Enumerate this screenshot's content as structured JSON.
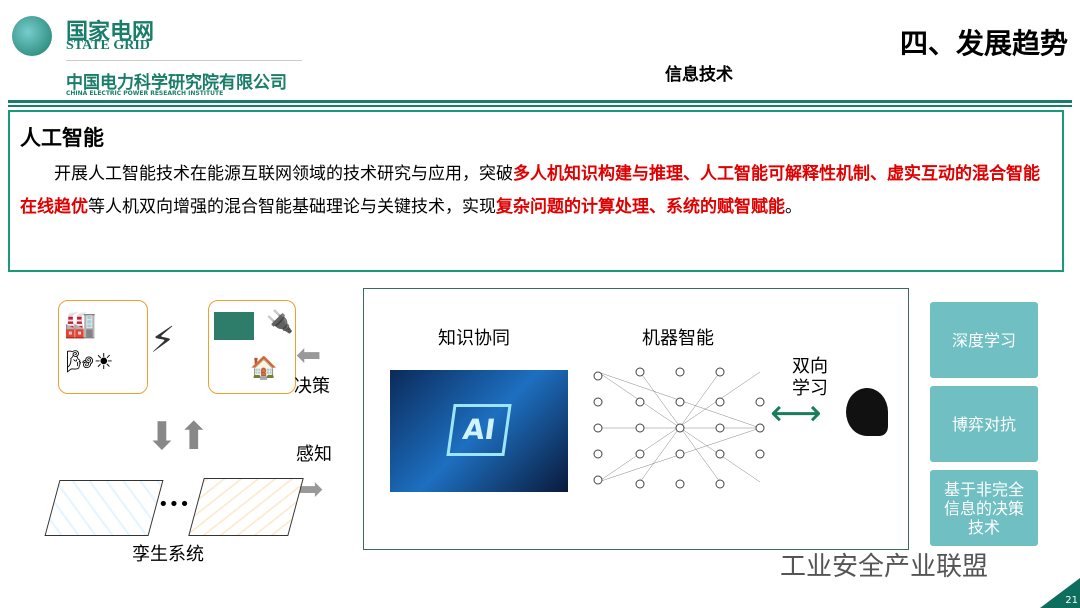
{
  "header": {
    "logo_cn": "国家电网",
    "logo_en": "STATE GRID",
    "institute_cn": "中国电力科学研究院有限公司",
    "institute_en": "CHINA ELECTRIC POWER RESEARCH INSTITUTE",
    "section_title": "四、发展趋势",
    "subtitle": "信息技术"
  },
  "content": {
    "heading": "人工智能",
    "p1": "开展人工智能技术在能源互联网领域的技术研究与应用，突破",
    "r1": "多人机知识构建与推理、人工智能可解释性机制、虚实互动的混合智能在线趋优",
    "p2": "等人机双向增强的混合智能基础理论与关键技术，实现",
    "r2": "复杂问题的计算处理、系统的赋智赋能",
    "p3": "。"
  },
  "diagram": {
    "decision": "决策",
    "perception": "感知",
    "twin": "孪生系统",
    "dots": "•••",
    "knowledge": "知识协同",
    "machine": "机器智能",
    "bidirectional": "双向\n学习",
    "ai_label": "AI"
  },
  "side": [
    "深度学习",
    "博弈对抗",
    "基于非完全信息的决策技术"
  ],
  "watermark": "工业安全产业联盟",
  "page_number": "21",
  "colors": {
    "brand": "#1a7d6a",
    "highlight": "#e00000",
    "side_box": "#6fbfc3"
  }
}
